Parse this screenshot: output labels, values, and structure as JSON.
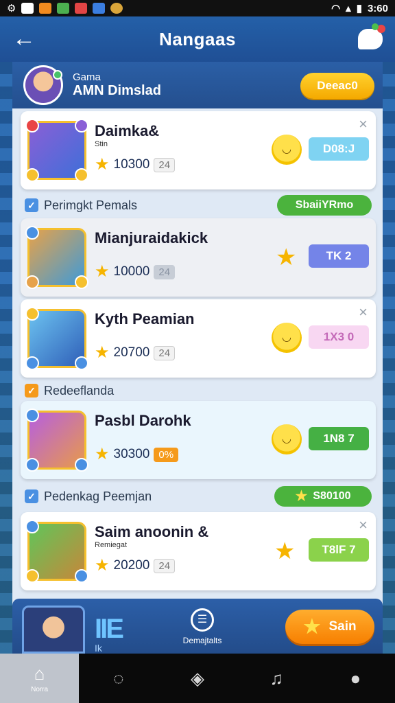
{
  "status_bar": {
    "time": "3:60",
    "left_icons": [
      "settings-icon",
      "image-icon",
      "app-icon-orange",
      "app-icon-green",
      "app-icon-red",
      "shield-icon",
      "game-icon"
    ],
    "right_icons": [
      "wifi-icon",
      "signal-icon",
      "battery-icon"
    ]
  },
  "header": {
    "title": "Nangaas",
    "back_icon": "arrow-left-icon",
    "chat_icon": "chat-bubble-icon"
  },
  "profile": {
    "subtitle": "Gama",
    "name": "AMN Dimslad",
    "button_label": "Deeac0"
  },
  "cards": [
    {
      "name": "Daimka&",
      "sub": "Stin",
      "score": "10300",
      "tag": "24",
      "pill": "D08:J",
      "pill_color": "#7fd3f2",
      "indicator": "mascot",
      "tag_style": "plain"
    },
    {
      "name": "Mianjuraidakick",
      "sub": "",
      "score": "10000",
      "tag": "24",
      "pill": "TK 2",
      "pill_color": "#7484e8",
      "indicator": "star",
      "tag_style": "gray"
    },
    {
      "name": "Kyth Peamian",
      "sub": "",
      "score": "20700",
      "tag": "24",
      "pill": "1X3 0",
      "pill_color": "#f8d7f2",
      "indicator": "mascot",
      "tag_style": "plain"
    },
    {
      "name": "Pasbl Darohk",
      "sub": "",
      "score": "30300",
      "tag": "0%",
      "pill": "1N8 7",
      "pill_color": "#45b044",
      "indicator": "mascot",
      "tag_style": "orange"
    },
    {
      "name": "Saim anoonin &",
      "sub": "Remiegat",
      "score": "20200",
      "tag": "24",
      "pill": "T8lF 7",
      "pill_color": "#8bd24b",
      "indicator": "star",
      "tag_style": "plain"
    }
  ],
  "sections": [
    {
      "label": "Perimgkt Pemals",
      "pill": "SbaiiYRmo"
    },
    {
      "label": "Redeeflanda",
      "pill": ""
    },
    {
      "label": "Pedenkag Peemjan",
      "pill": "S80100"
    }
  ],
  "bottom_panel": {
    "logo": "IIE",
    "logo_sub": "Ik",
    "center_label": "Demajtalts",
    "button_label": "Sain"
  },
  "nav": [
    {
      "label": "Norra",
      "icon": "home-icon"
    },
    {
      "label": "",
      "icon": "chat-search-icon"
    },
    {
      "label": "",
      "icon": "box-icon"
    },
    {
      "label": "",
      "icon": "music-icon"
    },
    {
      "label": "",
      "icon": "person-icon"
    }
  ]
}
